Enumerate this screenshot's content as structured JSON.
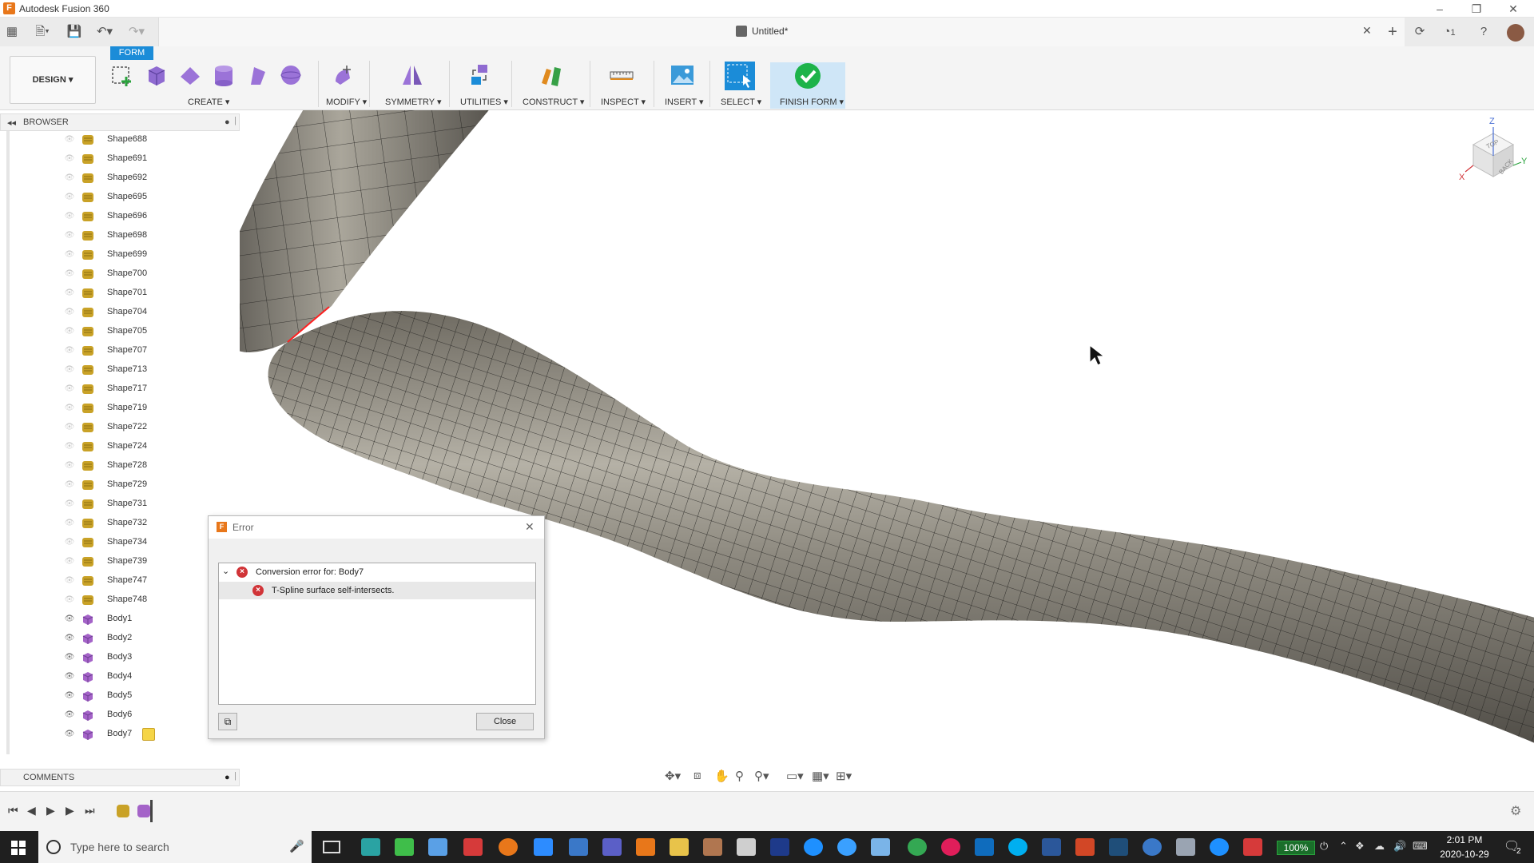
{
  "app": {
    "title": "Autodesk Fusion 360",
    "icon_letter": "F"
  },
  "document": {
    "title": "Untitled*"
  },
  "ribbon": {
    "active_tab": "FORM",
    "workspace": "DESIGN ▾",
    "groups": [
      {
        "label": "CREATE ▾"
      },
      {
        "label": "MODIFY ▾"
      },
      {
        "label": "SYMMETRY ▾"
      },
      {
        "label": "UTILITIES ▾"
      },
      {
        "label": "CONSTRUCT ▾"
      },
      {
        "label": "INSPECT ▾"
      },
      {
        "label": "INSERT ▾"
      },
      {
        "label": "SELECT ▾"
      },
      {
        "label": "FINISH FORM ▾"
      }
    ]
  },
  "notifications": {
    "count": "1"
  },
  "browser": {
    "title": "BROWSER",
    "items": [
      {
        "label": "Shape688",
        "kind": "shape",
        "visible": false
      },
      {
        "label": "Shape691",
        "kind": "shape",
        "visible": false
      },
      {
        "label": "Shape692",
        "kind": "shape",
        "visible": false
      },
      {
        "label": "Shape695",
        "kind": "shape",
        "visible": false
      },
      {
        "label": "Shape696",
        "kind": "shape",
        "visible": false
      },
      {
        "label": "Shape698",
        "kind": "shape",
        "visible": false
      },
      {
        "label": "Shape699",
        "kind": "shape",
        "visible": false
      },
      {
        "label": "Shape700",
        "kind": "shape",
        "visible": false
      },
      {
        "label": "Shape701",
        "kind": "shape",
        "visible": false
      },
      {
        "label": "Shape704",
        "kind": "shape",
        "visible": false
      },
      {
        "label": "Shape705",
        "kind": "shape",
        "visible": false
      },
      {
        "label": "Shape707",
        "kind": "shape",
        "visible": false
      },
      {
        "label": "Shape713",
        "kind": "shape",
        "visible": false
      },
      {
        "label": "Shape717",
        "kind": "shape",
        "visible": false
      },
      {
        "label": "Shape719",
        "kind": "shape",
        "visible": false
      },
      {
        "label": "Shape722",
        "kind": "shape",
        "visible": false
      },
      {
        "label": "Shape724",
        "kind": "shape",
        "visible": false
      },
      {
        "label": "Shape728",
        "kind": "shape",
        "visible": false
      },
      {
        "label": "Shape729",
        "kind": "shape",
        "visible": false
      },
      {
        "label": "Shape731",
        "kind": "shape",
        "visible": false
      },
      {
        "label": "Shape732",
        "kind": "shape",
        "visible": false
      },
      {
        "label": "Shape734",
        "kind": "shape",
        "visible": false
      },
      {
        "label": "Shape739",
        "kind": "shape",
        "visible": false
      },
      {
        "label": "Shape747",
        "kind": "shape",
        "visible": false
      },
      {
        "label": "Shape748",
        "kind": "shape",
        "visible": false
      },
      {
        "label": "Body1",
        "kind": "body",
        "visible": true
      },
      {
        "label": "Body2",
        "kind": "body",
        "visible": true
      },
      {
        "label": "Body3",
        "kind": "body",
        "visible": true
      },
      {
        "label": "Body4",
        "kind": "body",
        "visible": true
      },
      {
        "label": "Body5",
        "kind": "body",
        "visible": true
      },
      {
        "label": "Body6",
        "kind": "body",
        "visible": true
      },
      {
        "label": "Body7",
        "kind": "body",
        "visible": true
      }
    ]
  },
  "comments": {
    "title": "COMMENTS"
  },
  "dialog": {
    "title": "Error",
    "rows": [
      {
        "text": "Conversion error for: Body7",
        "level": 0
      },
      {
        "text": "T-Spline surface self-intersects.",
        "level": 1
      }
    ],
    "close_label": "Close"
  },
  "viewcube": {
    "z": "Z",
    "x": "X",
    "y": "Y",
    "top": "TOP",
    "back": "BACK"
  },
  "taskbar": {
    "search_placeholder": "Type here to search",
    "battery": "100%",
    "time": "2:01 PM",
    "date": "2020-10-29",
    "notif_count": "2"
  },
  "colors": {
    "accent": "#1b8cd8",
    "error": "#d13438",
    "finish": "#1db34a",
    "shape_icon": "#c9a227",
    "body_icon": "#a463c8"
  }
}
